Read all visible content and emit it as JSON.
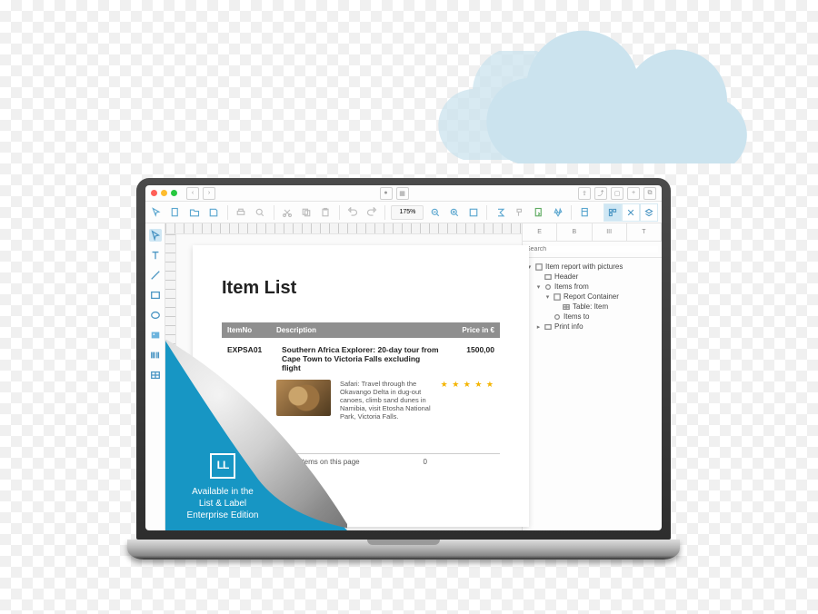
{
  "titlebar": {
    "zoom_label": "175%"
  },
  "toolbar": {
    "zoom_value": "175%"
  },
  "sidebar_search": {
    "placeholder": "Search"
  },
  "tree": {
    "root": "Item report with pictures",
    "header": "Header",
    "items_from": "Items from",
    "report_container": "Report Container",
    "table_item": "Table: Item",
    "items_to": "Items to",
    "print_info": "Print info"
  },
  "document": {
    "title": "Item List",
    "columns": {
      "itemno": "ItemNo",
      "description": "Description",
      "price": "Price in €"
    },
    "rows": [
      {
        "itemno": "EXPSA01",
        "description": "Southern Africa Explorer: 20-day tour from Cape Town to Victoria Falls excluding flight",
        "price": "1500,00",
        "detail": "Safari: Travel through the Okavango Delta in dug-out canoes, climb sand dunes in Namibia, visit Etosha National Park, Victoria Falls.",
        "stars": 5
      }
    ],
    "pager": {
      "items_label": "0 items on this page",
      "total": "0"
    }
  },
  "promo": {
    "logo": "LL",
    "line1": "Available in the",
    "line2": "List & Label",
    "line3": "Enterprise Edition"
  },
  "panel_tabs": [
    "E",
    "B",
    "III",
    "T"
  ],
  "colors": {
    "accent": "#1796c4"
  }
}
